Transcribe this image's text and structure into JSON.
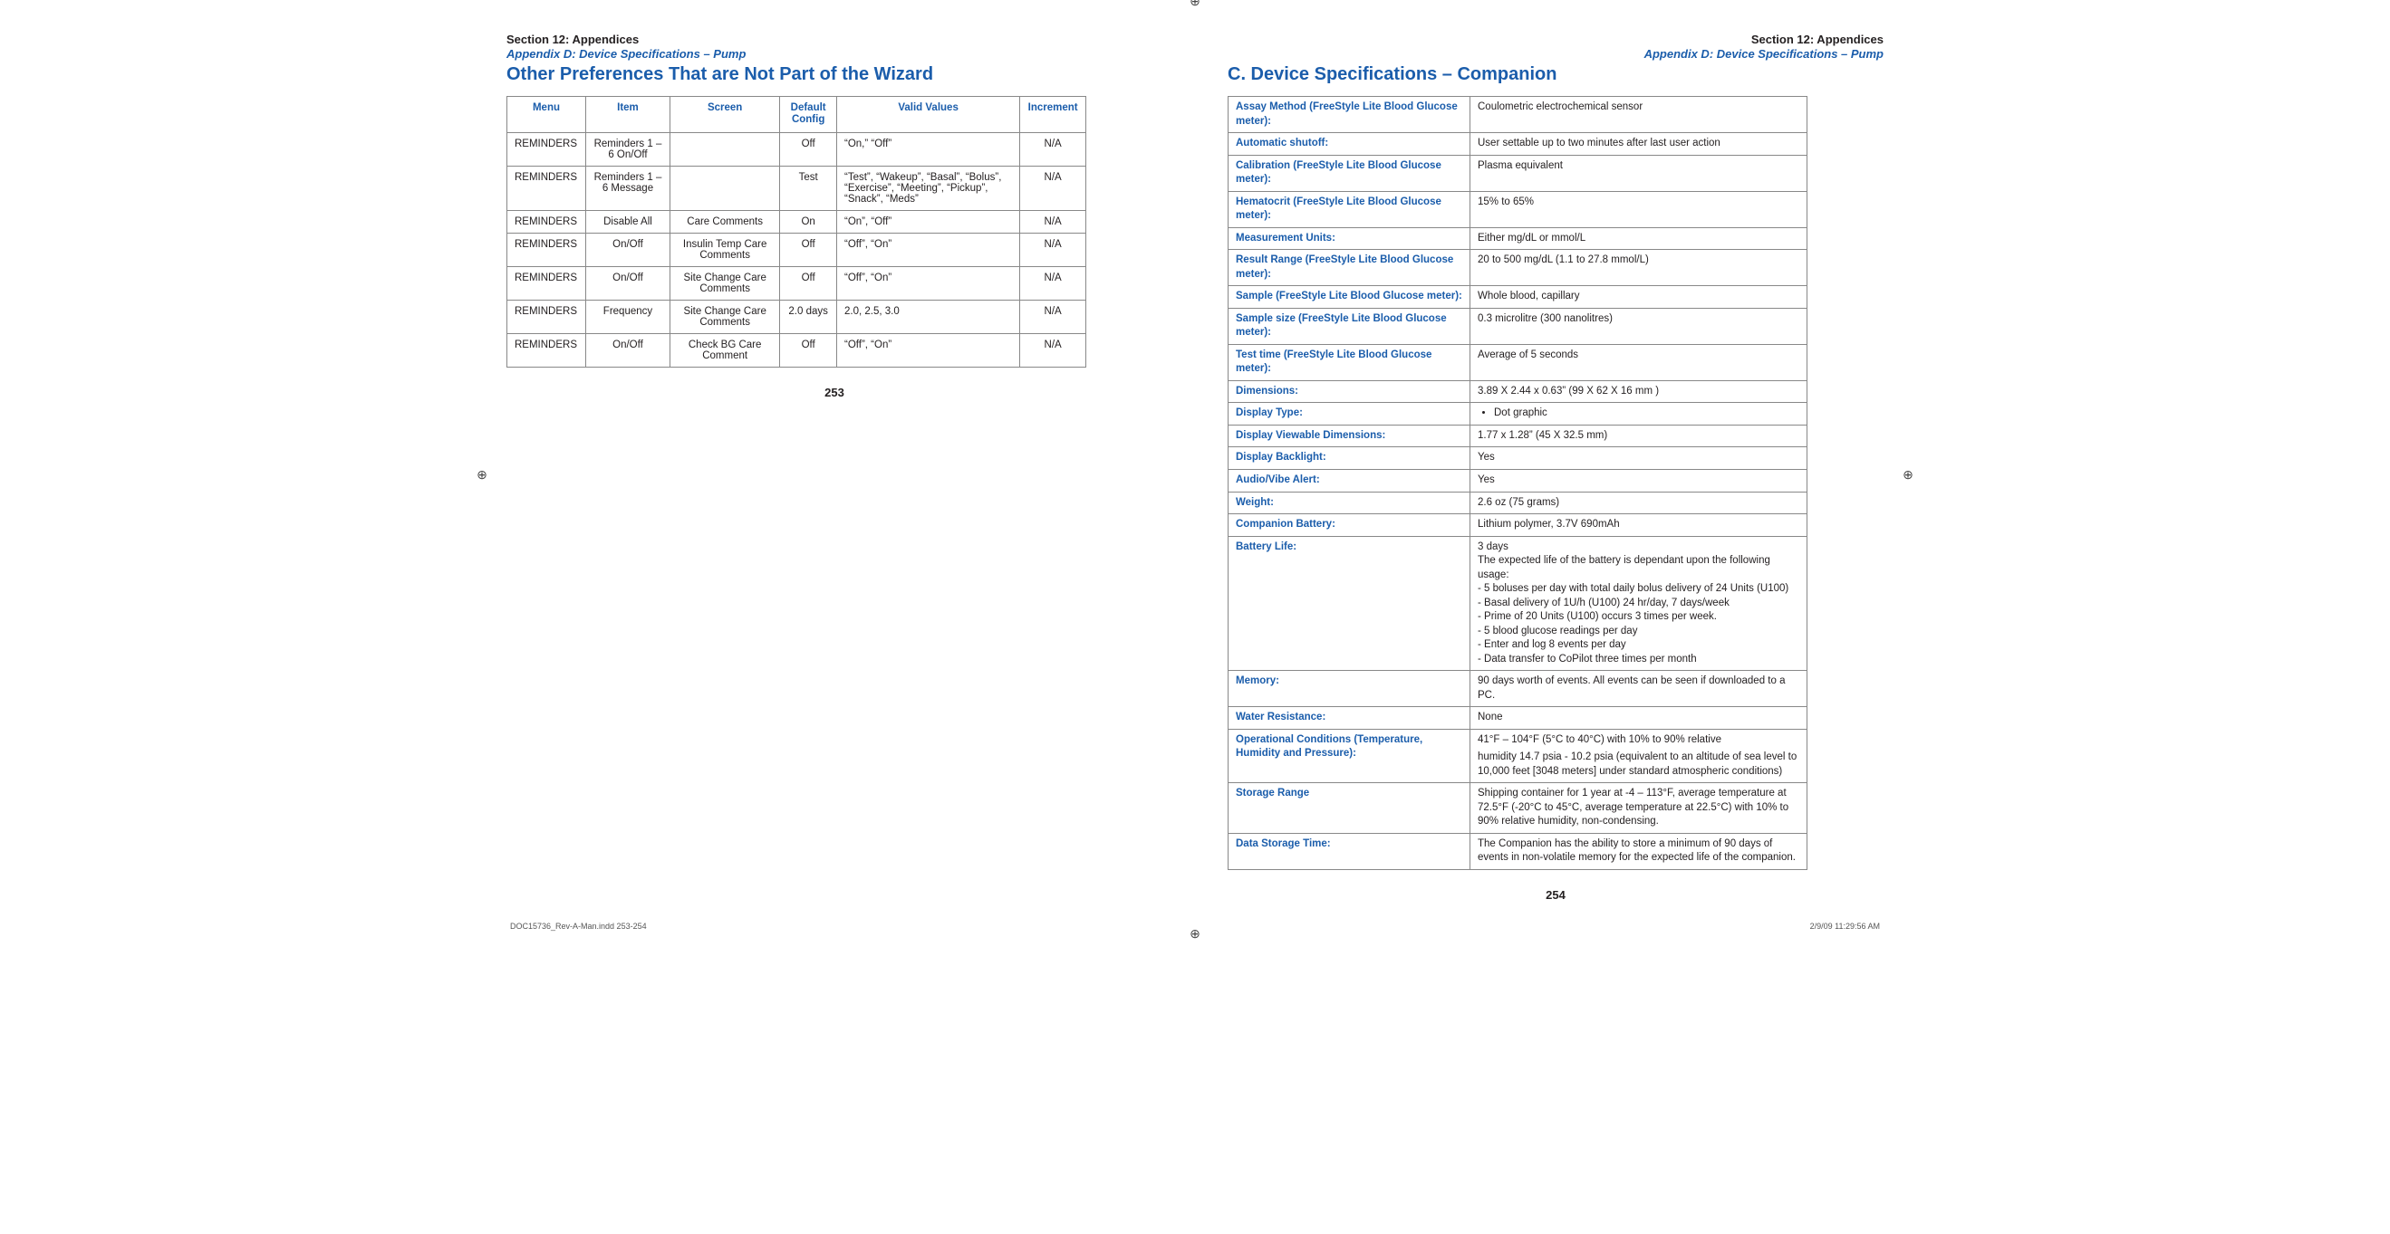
{
  "left": {
    "section": "Section 12: Appendices",
    "appendix": "Appendix D: Device Specifications – Pump",
    "title": "Other Preferences That are Not Part of the Wizard",
    "headers": {
      "menu": "Menu",
      "item": "Item",
      "screen": "Screen",
      "default": "Default Config",
      "valid": "Valid Values",
      "increment": "Increment"
    },
    "rows": [
      {
        "menu": "REMINDERS",
        "item": "Reminders 1 – 6 On/Off",
        "screen": "",
        "default": "Off",
        "valid": "“On,” “Off”",
        "increment": "N/A"
      },
      {
        "menu": "REMINDERS",
        "item": "Reminders 1 – 6 Message",
        "screen": "",
        "default": "Test",
        "valid": "“Test”, “Wakeup”, “Basal”, “Bolus”, “Exercise”, “Meeting”, “Pickup”, “Snack”, “Meds”",
        "increment": "N/A"
      },
      {
        "menu": "REMINDERS",
        "item": "Disable All",
        "screen": "Care Comments",
        "default": "On",
        "valid": "“On”, “Off”",
        "increment": "N/A"
      },
      {
        "menu": "REMINDERS",
        "item": "On/Off",
        "screen": "Insulin Temp Care Comments",
        "default": "Off",
        "valid": "“Off”, “On”",
        "increment": "N/A"
      },
      {
        "menu": "REMINDERS",
        "item": "On/Off",
        "screen": "Site Change Care Comments",
        "default": "Off",
        "valid": "“Off”, “On”",
        "increment": "N/A"
      },
      {
        "menu": "REMINDERS",
        "item": "Frequency",
        "screen": "Site Change Care Comments",
        "default": "2.0 days",
        "valid": "2.0, 2.5, 3.0",
        "increment": "N/A"
      },
      {
        "menu": "REMINDERS",
        "item": "On/Off",
        "screen": "Check BG Care Comment",
        "default": "Off",
        "valid": "“Off”, “On”",
        "increment": "N/A"
      }
    ],
    "pageNumber": "253"
  },
  "right": {
    "section": "Section 12: Appendices",
    "appendix": "Appendix D: Device Specifications – Pump",
    "title": "C.  Device Specifications – Companion",
    "rows": [
      {
        "label": "Assay Method (FreeStyle Lite Blood Glucose meter):",
        "value": "Coulometric electrochemical sensor"
      },
      {
        "label": "Automatic shutoff:",
        "value": "User settable up to two minutes after last user action"
      },
      {
        "label": "Calibration (FreeStyle Lite Blood Glucose meter):",
        "value": "Plasma equivalent"
      },
      {
        "label": "Hematocrit (FreeStyle Lite Blood Glucose meter):",
        "value": "15% to 65%"
      },
      {
        "label": "Measurement Units:",
        "value": "Either mg/dL or mmol/L"
      },
      {
        "label": "Result Range (FreeStyle Lite Blood Glucose meter):",
        "value": "20 to 500 mg/dL (1.1 to 27.8 mmol/L)"
      },
      {
        "label": "Sample (FreeStyle Lite Blood Glucose meter):",
        "value": "Whole blood, capillary"
      },
      {
        "label": "Sample size (FreeStyle Lite Blood Glucose meter):",
        "value": "0.3 microlitre (300 nanolitres)"
      },
      {
        "label": "Test time (FreeStyle Lite Blood Glucose meter):",
        "value": "Average of 5 seconds"
      },
      {
        "label": "Dimensions:",
        "value": "3.89 X 2.44 x 0.63” (99 X 62 X 16 mm )"
      },
      {
        "label": "Display Type:",
        "bullet": "Dot graphic"
      },
      {
        "label": "Display Viewable Dimensions:",
        "value": "1.77 x 1.28” (45 X 32.5 mm)"
      },
      {
        "label": "Display Backlight:",
        "value": "Yes"
      },
      {
        "label": "Audio/Vibe Alert:",
        "value": "Yes"
      },
      {
        "label": "Weight:",
        "value": "2.6 oz (75 grams)"
      },
      {
        "label": "Companion Battery:",
        "value": "Lithium polymer, 3.7V 690mAh"
      },
      {
        "label": "Battery Life:",
        "lines": [
          "3 days",
          "The expected life of the battery is dependant upon the following usage:",
          "- 5 boluses per day with total daily bolus delivery of 24 Units (U100)",
          "- Basal delivery of 1U/h (U100) 24 hr/day, 7 days/week",
          "- Prime of 20 Units (U100) occurs 3 times per week.",
          "- 5 blood glucose readings per day",
          "- Enter and log 8 events per day",
          "- Data transfer to CoPilot three times per month"
        ]
      },
      {
        "label": "Memory:",
        "value": "90 days worth of events. All events can be seen if downloaded to a PC."
      },
      {
        "label": "Water Resistance:",
        "value": "None"
      },
      {
        "label": "Operational Conditions (Temperature, Humidity and Pressure):",
        "lines": [
          "41°F – 104°F (5°C to 40°C) with 10% to 90% relative",
          "humidity 14.7 psia - 10.2 psia (equivalent to an altitude of sea level to 10,000 feet [3048 meters] under standard atmospheric conditions)"
        ]
      },
      {
        "label": "Storage Range",
        "value": "Shipping container for 1 year at -4 – 113°F, average temperature at 72.5°F (-20°C to 45°C, average temperature at 22.5°C) with 10% to 90% relative humidity, non-condensing."
      },
      {
        "label": "Data Storage Time:",
        "value": "The Companion has the ability to store a minimum of 90 days of events in non-volatile memory for the expected life of the companion."
      }
    ],
    "pageNumber": "254"
  },
  "footer": {
    "file": "DOC15736_Rev-A-Man.indd   253-254",
    "stamp": "2/9/09   11:29:56 AM"
  }
}
